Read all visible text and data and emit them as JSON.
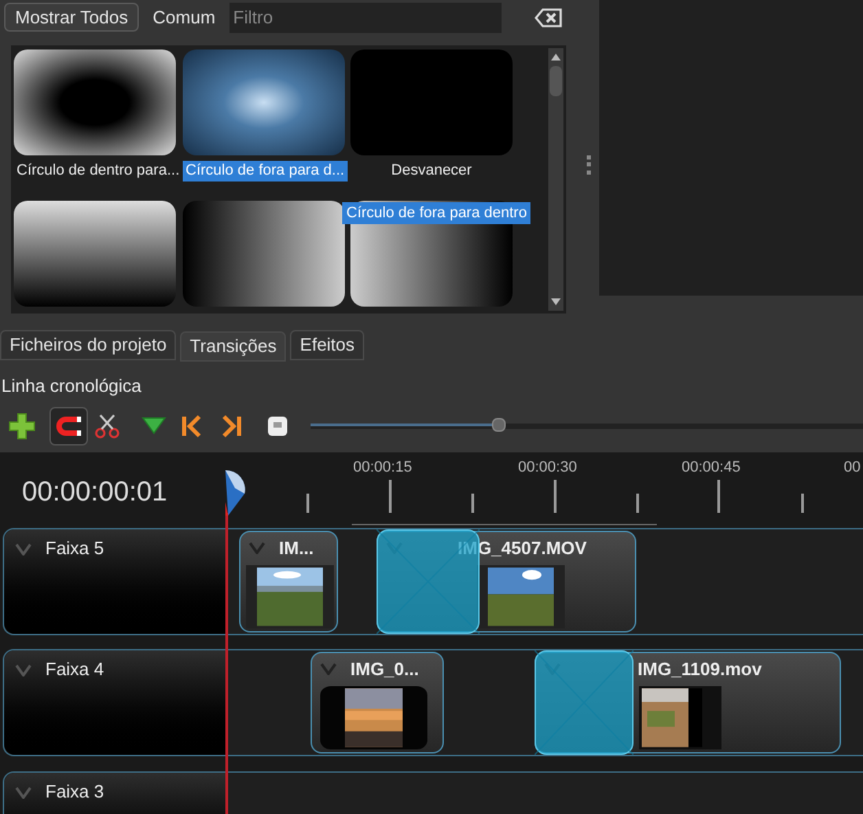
{
  "filter_bar": {
    "buttons": [
      {
        "label": "Mostrar Todos",
        "selected": true
      },
      {
        "label": "Comum",
        "selected": false
      }
    ],
    "filter": {
      "placeholder": "Filtro"
    }
  },
  "transitions": [
    {
      "label": "Círculo de dentro para...",
      "selected": false
    },
    {
      "label": "Círculo de fora para d...",
      "selected": true
    },
    {
      "label": "Desvanecer",
      "selected": false
    },
    {
      "selected": false
    },
    {
      "selected": false
    },
    {
      "selected": false
    }
  ],
  "tooltip": "Círculo de fora para dentro",
  "tabs": [
    {
      "label": "Ficheiros do projeto",
      "selected": false
    },
    {
      "label": "Transições",
      "selected": true
    },
    {
      "label": "Efeitos",
      "selected": false
    }
  ],
  "timeline": {
    "title": "Linha cronológica",
    "snapping_on": true,
    "zoom": {
      "level": 0.34
    },
    "timecode": "00:00:00:01",
    "ruler": [
      "00:00:15",
      "00:00:30",
      "00:00:45",
      "00"
    ],
    "tracks": [
      {
        "name": "Faixa 5",
        "clips": [
          {
            "name": "IM..."
          },
          {
            "name": "IMG_4507.MOV"
          }
        ]
      },
      {
        "name": "Faixa 4",
        "clips": [
          {
            "name": "IMG_0..."
          },
          {
            "name": "IMG_1109.mov"
          }
        ]
      },
      {
        "name": "Faixa 3"
      }
    ]
  }
}
